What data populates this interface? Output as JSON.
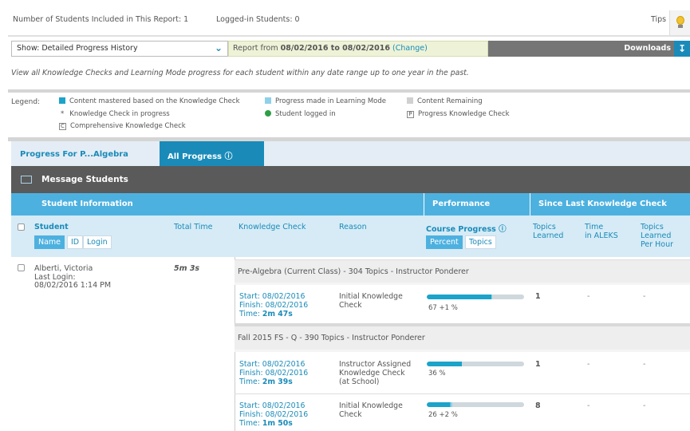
{
  "header": {
    "students_included": "Number of Students Included in This Report: 1",
    "logged_in": "Logged-in Students: 0",
    "tips": "Tips"
  },
  "controls": {
    "show_label": "Show: Detailed Progress History",
    "report_prefix": "Report from",
    "report_range": "08/02/2016 to 08/02/2016",
    "change_link": "(Change)",
    "downloads": "Downloads"
  },
  "description": "View all Knowledge Checks and Learning Mode progress for each student within any date range up to one year in the past.",
  "legend": {
    "title": "Legend:",
    "mastered": "Content mastered based on the Knowledge Check",
    "in_progress": "Knowledge Check in progress",
    "comprehensive": "Comprehensive Knowledge Check",
    "learning_mode": "Progress made in Learning Mode",
    "logged_in": "Student logged in",
    "remaining": "Content Remaining",
    "progress_kc": "Progress Knowledge Check",
    "colors": {
      "mastered": "#1ba3c9",
      "learning_mode": "#8fd0ea",
      "remaining": "#d0d0d0",
      "logged_in": "#2e9e46"
    }
  },
  "tabs": {
    "progress_for": "Progress For P...Algebra",
    "all_progress": "All Progress ⓘ"
  },
  "message_students": "Message Students",
  "sections": {
    "student_info": "Student Information",
    "performance": "Performance",
    "since_last": "Since Last Knowledge Check"
  },
  "columns": {
    "student": "Student",
    "name": "Name",
    "id": "ID",
    "login": "Login",
    "total_time": "Total Time",
    "knowledge_check": "Knowledge Check",
    "reason": "Reason",
    "course_progress": "Course Progress ⓘ",
    "percent": "Percent",
    "topics": "Topics",
    "topics_learned_1": "Topics",
    "topics_learned_2": "Learned",
    "time_aleks_1": "Time",
    "time_aleks_2": "in ALEKS",
    "per_hour_1": "Topics",
    "per_hour_2": "Learned",
    "per_hour_3": "Per Hour"
  },
  "student": {
    "name": "Alberti, Victoria",
    "last_login_label": "Last Login:",
    "last_login": "08/02/2016 1:14 PM",
    "total_time": "5m 3s"
  },
  "classes": [
    {
      "title": "Pre-Algebra (Current Class) - 304 Topics - Instructor Ponderer",
      "attempts": [
        {
          "start": "Start: 08/02/2016",
          "finish": "Finish: 08/02/2016",
          "time_label": "Time:",
          "time": "2m 47s",
          "reason_1": "Initial Knowledge",
          "reason_2": "Check",
          "reason_3": "",
          "mastered": 0.66,
          "learning": 0.01,
          "label": "67 +1 %",
          "topics_learned": "1",
          "time_aleks": "-",
          "per_hour": "-"
        }
      ]
    },
    {
      "title": "Fall 2015 FS - Q - 390 Topics - Instructor Ponderer",
      "attempts": [
        {
          "start": "Start: 08/02/2016",
          "finish": "Finish: 08/02/2016",
          "time_label": "Time:",
          "time": "2m 39s",
          "reason_1": "Instructor Assigned",
          "reason_2": "Knowledge Check",
          "reason_3": "(at School)",
          "mastered": 0.36,
          "learning": 0,
          "label": "36 %",
          "topics_learned": "1",
          "time_aleks": "-",
          "per_hour": "-"
        },
        {
          "start": "Start: 08/02/2016",
          "finish": "Finish: 08/02/2016",
          "time_label": "Time:",
          "time": "1m 50s",
          "reason_1": "Initial Knowledge",
          "reason_2": "Check",
          "reason_3": "",
          "mastered": 0.24,
          "learning": 0.02,
          "label": "26 +2 %",
          "topics_learned": "8",
          "time_aleks": "-",
          "per_hour": "-"
        }
      ]
    }
  ]
}
